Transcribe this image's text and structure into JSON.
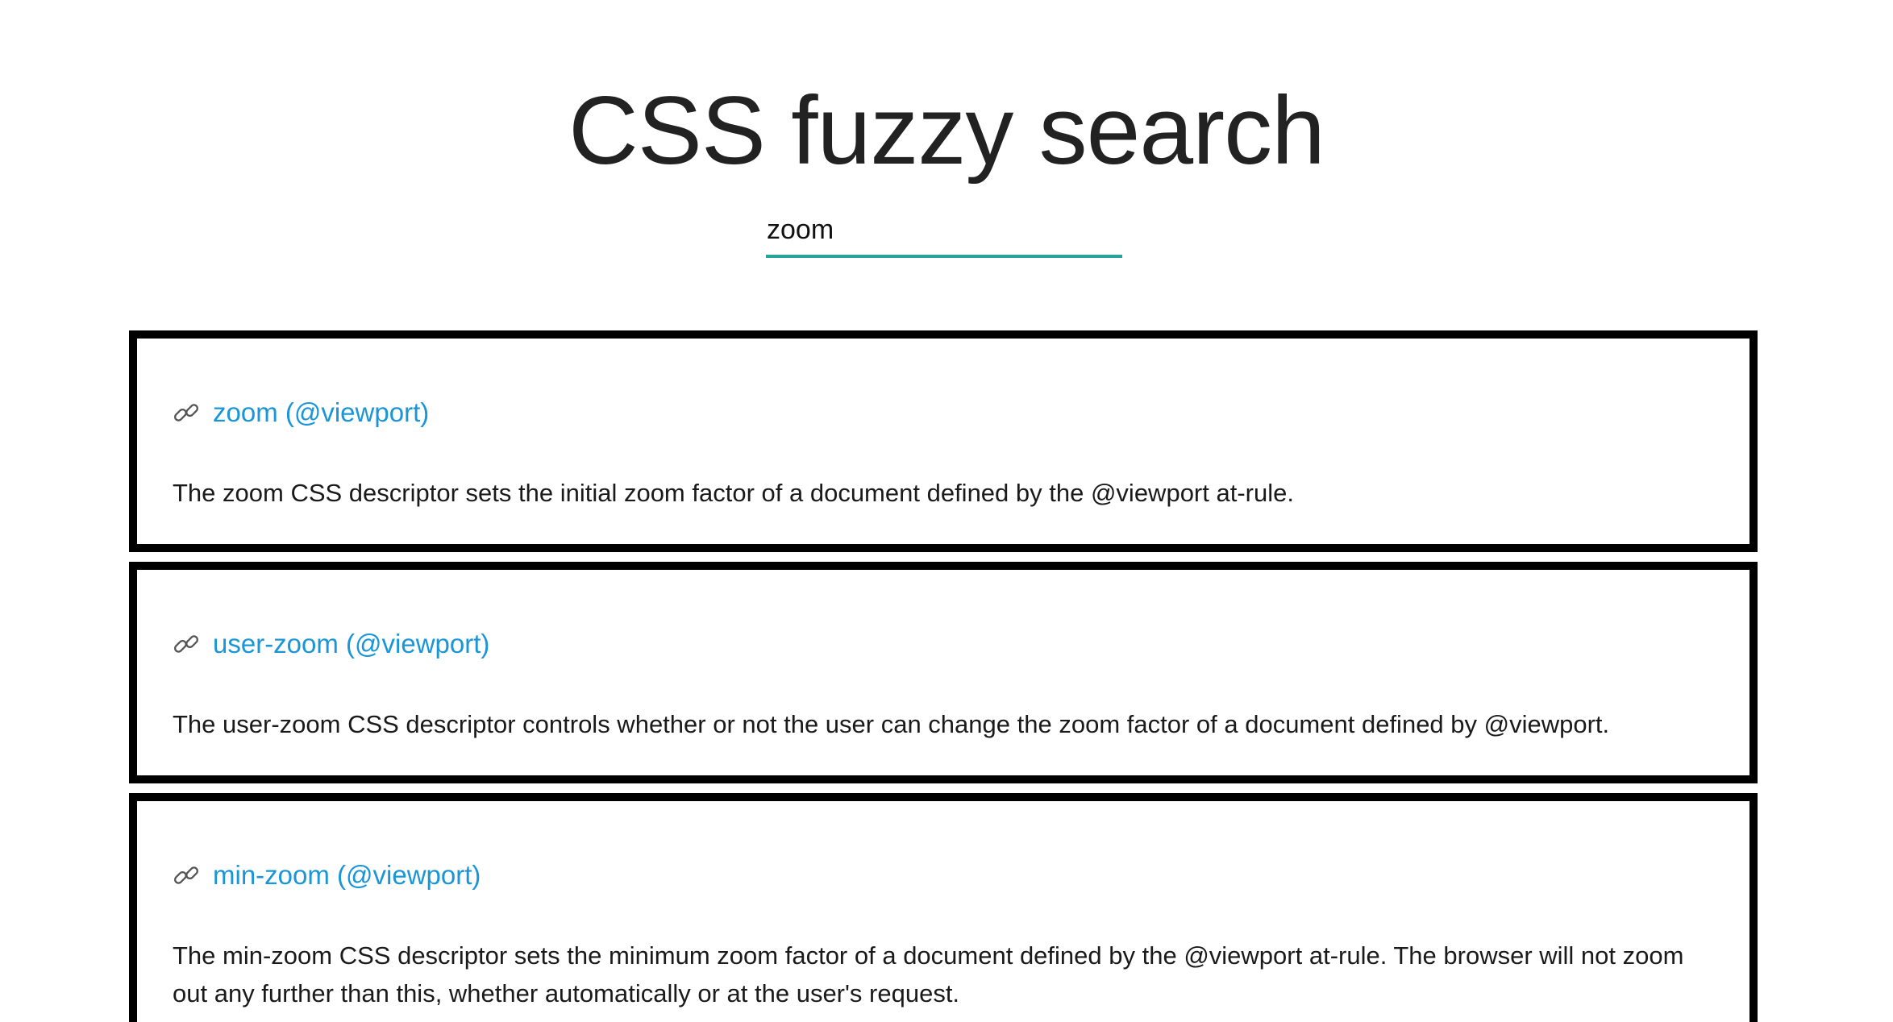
{
  "header": {
    "title": "CSS fuzzy search"
  },
  "search": {
    "value": "zoom",
    "placeholder": ""
  },
  "theme": {
    "accent": "#26a69a",
    "link": "#1a96d8",
    "border": "#000000",
    "link_icon": "link-icon"
  },
  "results": [
    {
      "title": "zoom (@viewport)",
      "description": "The zoom CSS descriptor sets the initial zoom factor of a document defined by the @viewport at-rule."
    },
    {
      "title": "user-zoom (@viewport)",
      "description": "The user-zoom CSS descriptor controls whether or not the user can change the zoom factor of a document defined by @viewport."
    },
    {
      "title": "min-zoom (@viewport)",
      "description": "The min-zoom CSS descriptor sets the minimum zoom factor of a document defined by the @viewport at-rule. The browser will not zoom out any further than this, whether automatically or at the user's request."
    }
  ]
}
